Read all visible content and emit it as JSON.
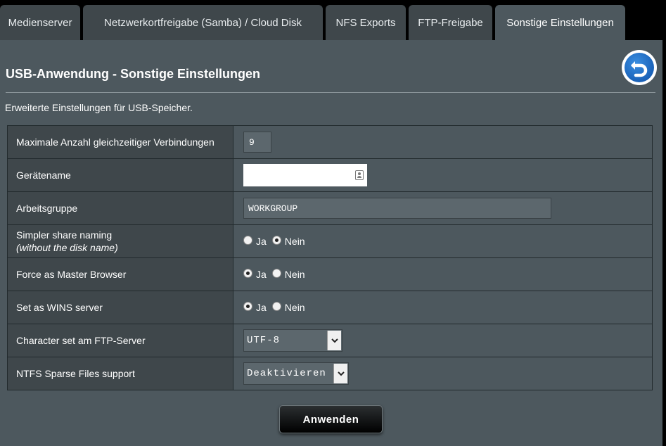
{
  "tabs": [
    {
      "label": "Medienserver"
    },
    {
      "label": "Netzwerkortfreigabe (Samba) / Cloud Disk"
    },
    {
      "label": "NFS Exports"
    },
    {
      "label": "FTP-Freigabe"
    },
    {
      "label": "Sonstige Einstellungen"
    }
  ],
  "active_tab": "Sonstige Einstellungen",
  "page": {
    "title": "USB-Anwendung - Sonstige Einstellungen",
    "description": "Erweiterte Einstellungen für USB-Speicher.",
    "back_icon": "back-arrow-icon"
  },
  "settings": {
    "max_connections": {
      "label": "Maximale Anzahl gleichzeitiger Verbindungen",
      "value": "9"
    },
    "device_name": {
      "label": "Gerätename",
      "value": ""
    },
    "workgroup": {
      "label": "Arbeitsgruppe",
      "value": "WORKGROUP"
    },
    "simple_share": {
      "label": "Simpler share naming",
      "sublabel": "(without the disk name)",
      "yes": "Ja",
      "no": "Nein",
      "selected": "Nein"
    },
    "master_browser": {
      "label": "Force as Master Browser",
      "yes": "Ja",
      "no": "Nein",
      "selected": "Ja"
    },
    "wins_server": {
      "label": "Set as WINS server",
      "yes": "Ja",
      "no": "Nein",
      "selected": "Ja"
    },
    "ftp_charset": {
      "label": "Character set am FTP-Server",
      "value": "UTF-8"
    },
    "ntfs_sparse": {
      "label": "NTFS Sparse Files support",
      "value": "Deaktivieren"
    }
  },
  "apply_label": "Anwenden",
  "colors": {
    "tab_bg": "#3f474b",
    "panel_bg": "#4d585e",
    "label_cell_bg": "#3f474b",
    "back_button_blue": "#1a64c0"
  }
}
